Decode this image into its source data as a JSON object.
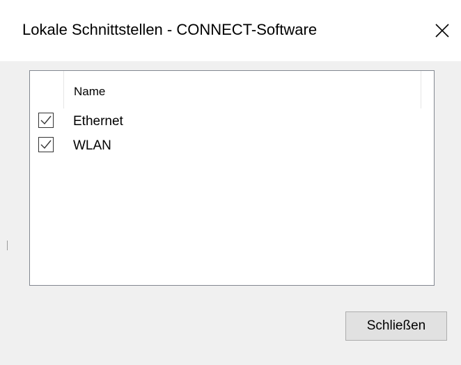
{
  "window": {
    "title": "Lokale Schnittstellen - CONNECT-Software"
  },
  "list": {
    "column_header": "Name",
    "rows": [
      {
        "label": "Ethernet",
        "checked": true
      },
      {
        "label": "WLAN",
        "checked": true
      }
    ]
  },
  "buttons": {
    "close_label": "Schließen"
  },
  "icons": {
    "close": "close-icon",
    "checkmark": "checkmark-icon"
  },
  "colors": {
    "titlebar_bg": "#ffffff",
    "dialog_bg": "#f0f0f0",
    "list_border": "#828790",
    "button_bg": "#e1e1e1",
    "button_border": "#adadad"
  }
}
